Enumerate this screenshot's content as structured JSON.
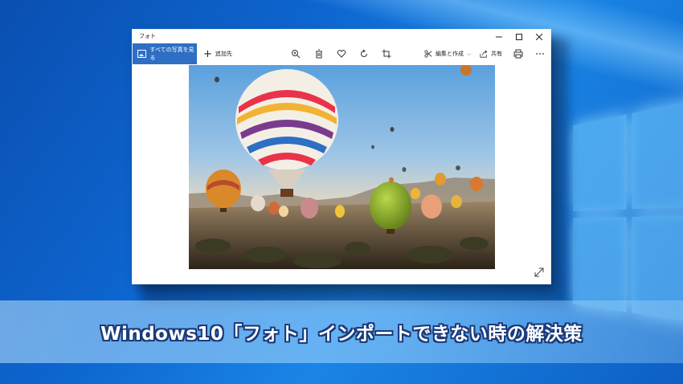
{
  "window": {
    "title": "フォト"
  },
  "toolbar": {
    "all_photos_label": "すべての写真を見る",
    "add_to_label": "追加先",
    "edit_label": "編集と作成",
    "share_label": "共有",
    "icons": [
      "zoom-icon",
      "delete-icon",
      "favorite-icon",
      "rotate-icon",
      "crop-icon",
      "print-icon",
      "more-icon"
    ]
  },
  "banner": {
    "text": "Windows10「フォト」インポートできない時の解決策"
  },
  "colors": {
    "accent": "#2e6fc4",
    "banner_outline": "#1a3a7a"
  }
}
